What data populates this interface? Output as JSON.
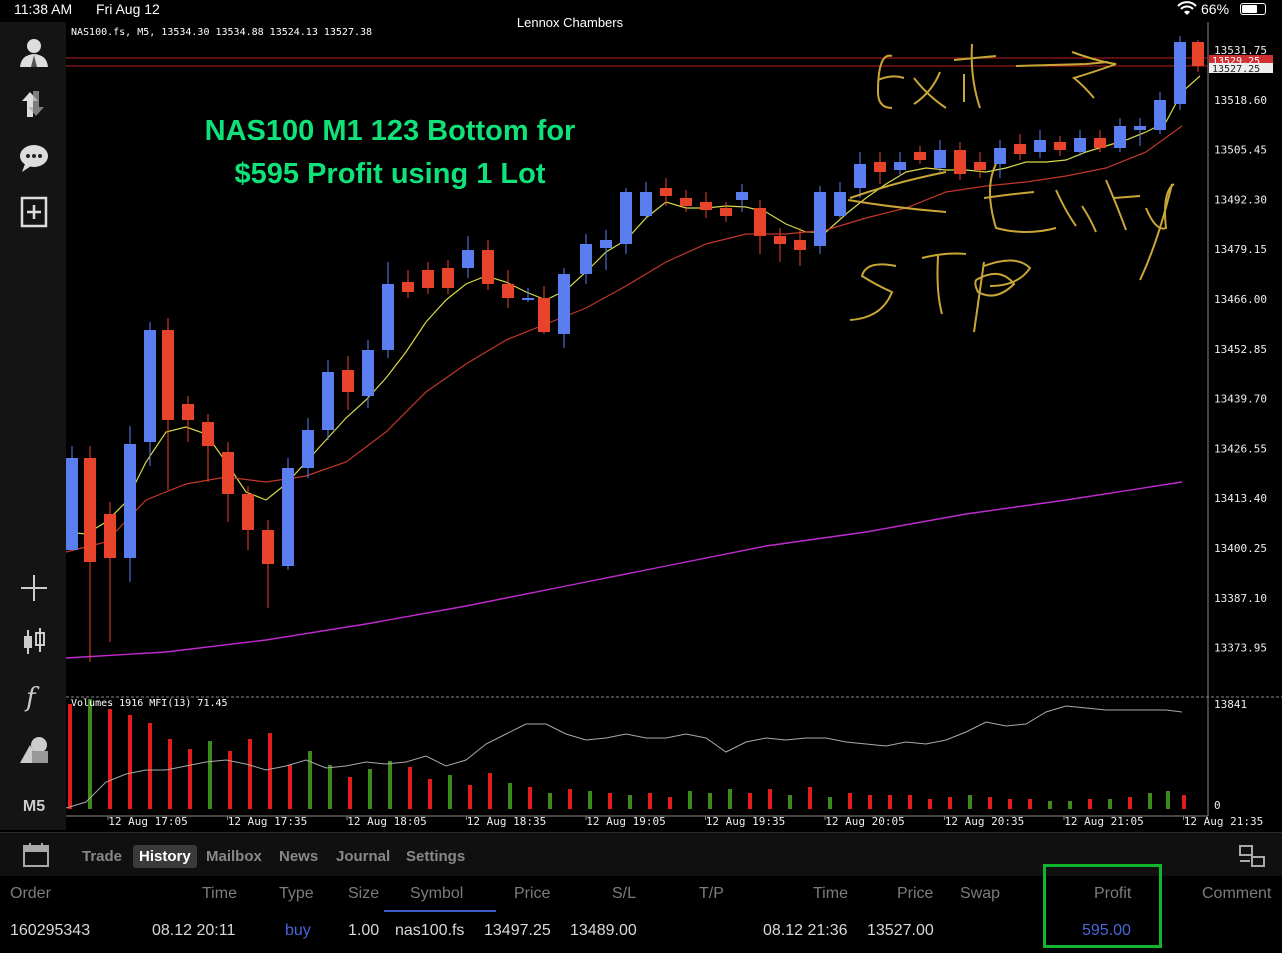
{
  "status": {
    "time": "11:38 AM",
    "date": "Fri Aug 12",
    "center": "Lennox Chambers",
    "battery": "66%"
  },
  "chart": {
    "ohlc": "NAS100.fs, M5, 13534.30 13534.88 13524.13 13527.38",
    "headline_1": "NAS100 M1 123 Bottom for",
    "headline_2": "$595 Profit using 1 Lot",
    "volume_header": "Volumes 1916 MFI(13) 71.45",
    "price_ticks": [
      "13531.75",
      "13518.60",
      "13505.45",
      "13492.30",
      "13479.15",
      "13466.00",
      "13452.85",
      "13439.70",
      "13426.55",
      "13413.40",
      "13400.25",
      "13387.10",
      "13373.95"
    ],
    "price_tags": [
      "13529.25",
      "13527.25"
    ],
    "volume_ticks": [
      "13841",
      "0"
    ],
    "time_ticks": [
      "12 Aug 17:05",
      "12 Aug 17:35",
      "12 Aug 18:05",
      "12 Aug 18:35",
      "12 Aug 19:05",
      "12 Aug 19:35",
      "12 Aug 20:05",
      "12 Aug 20:35",
      "12 Aug 21:05",
      "12 Aug 21:35"
    ],
    "handwriting_exit": "Exit →",
    "handwriting_entry": "Entry",
    "handwriting_stop": "stop",
    "colors": {
      "bull": "#5a7ef0",
      "bear": "#e8442c",
      "ma_fast": "#d8d84a",
      "ma_slow": "#c0382a",
      "ma_long": "#c02ad0",
      "vol_up": "#3e8a1e",
      "vol_down": "#e01c1c",
      "annot": "#c9a736"
    }
  },
  "left_toolbar": {
    "icons": [
      "account-icon",
      "trade-arrows-icon",
      "chat-icon",
      "new-document-icon",
      "crosshair-icon",
      "candle-type-icon",
      "function-icon",
      "objects-icon"
    ],
    "timeframe": "M5"
  },
  "tabs": [
    "Trade",
    "History",
    "Mailbox",
    "News",
    "Journal",
    "Settings"
  ],
  "history": {
    "headers": [
      "Order",
      "Time",
      "Type",
      "Size",
      "Symbol",
      "Price",
      "S/L",
      "T/P",
      "Time",
      "Price",
      "Swap",
      "Profit",
      "Comment"
    ],
    "row": {
      "order": "160295343",
      "open_time": "08.12 20:11",
      "type": "buy",
      "size": "1.00",
      "symbol": "nas100.fs",
      "open_price": "13497.25",
      "sl": "13489.00",
      "tp": "",
      "close_time": "08.12 21:36",
      "close_price": "13527.00",
      "swap": "",
      "profit": "595.00",
      "comment": ""
    }
  }
}
